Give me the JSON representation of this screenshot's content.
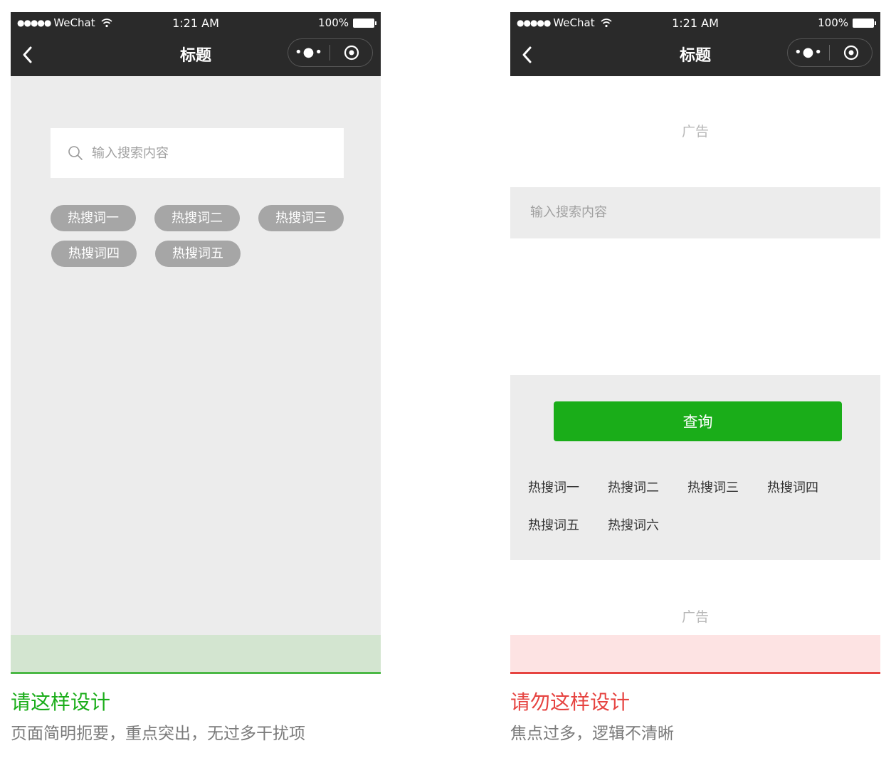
{
  "status_bar": {
    "carrier": "WeChat",
    "signal_dots": "●●●●●",
    "time": "1:21 AM",
    "battery": "100%"
  },
  "nav": {
    "title": "标题",
    "more": "•●•"
  },
  "good_example": {
    "search_placeholder": "输入搜索内容",
    "hot_words": [
      "热搜词一",
      "热搜词二",
      "热搜词三",
      "热搜词四",
      "热搜词五"
    ],
    "caption_title": "请这样设计",
    "caption_desc": "页面简明扼要，重点突出，无过多干扰项"
  },
  "bad_example": {
    "ad_label": "广告",
    "search_placeholder": "输入搜索内容",
    "query_button": "查询",
    "hot_words": [
      "热搜词一",
      "热搜词二",
      "热搜词三",
      "热搜词四",
      "热搜词五",
      "热搜词六"
    ],
    "caption_title": "请勿这样设计",
    "caption_desc": "焦点过多，逻辑不清晰"
  },
  "colors": {
    "wechat_green": "#1aad19",
    "error_red": "#e64340",
    "header_dark": "#2a2a2a",
    "chip_gray": "#a6a6a6"
  }
}
